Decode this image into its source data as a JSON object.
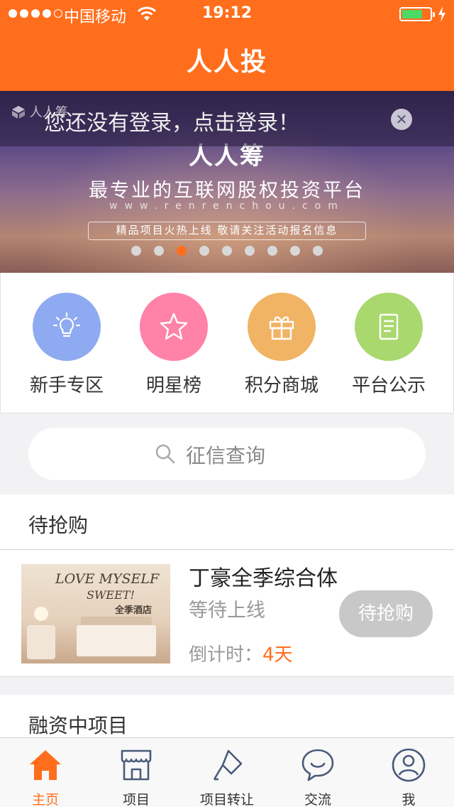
{
  "status_bar": {
    "carrier": "中国移动",
    "time": "19:12"
  },
  "header": {
    "title": "人人投"
  },
  "banner": {
    "login_prompt": "您还没有登录，点击登录！",
    "brand_mark": "人人筹",
    "brand": "人人筹",
    "slogan": "最专业的互联网股权投资平台",
    "url": "www.renrenchou.com",
    "notice": "精品项目火热上线 敬请关注活动报名信息",
    "slide_count": 9,
    "active_slide": 3
  },
  "quick_entries": [
    {
      "label": "新手专区",
      "icon": "lightbulb-icon",
      "color": "#8eaaf0"
    },
    {
      "label": "明星榜",
      "icon": "star-icon",
      "color": "#ff82a9"
    },
    {
      "label": "积分商城",
      "icon": "gift-icon",
      "color": "#f0b464"
    },
    {
      "label": "平台公示",
      "icon": "document-icon",
      "color": "#a9d86e"
    }
  ],
  "search": {
    "placeholder": "征信查询"
  },
  "sections": {
    "pending": {
      "title": "待抢购"
    },
    "financing": {
      "title": "融资中项目"
    }
  },
  "project": {
    "image_text_line1": "LOVE MYSELF",
    "image_text_line2": "SWEET!",
    "image_text_line3": "全季酒店",
    "name": "丁豪全季综合体",
    "status": "等待上线",
    "countdown_label": "倒计时：",
    "countdown_value": "4天",
    "button": "待抢购"
  },
  "tabbar": [
    {
      "label": "主页",
      "icon": "home-icon",
      "active": true
    },
    {
      "label": "项目",
      "icon": "storefront-icon",
      "active": false
    },
    {
      "label": "项目转让",
      "icon": "transfer-icon",
      "active": false
    },
    {
      "label": "交流",
      "icon": "chat-icon",
      "active": false
    },
    {
      "label": "我",
      "icon": "user-icon",
      "active": false
    }
  ],
  "colors": {
    "brand": "#ff6e1c",
    "inactive_button": "#c8c8c8",
    "muted_text": "#999999"
  }
}
